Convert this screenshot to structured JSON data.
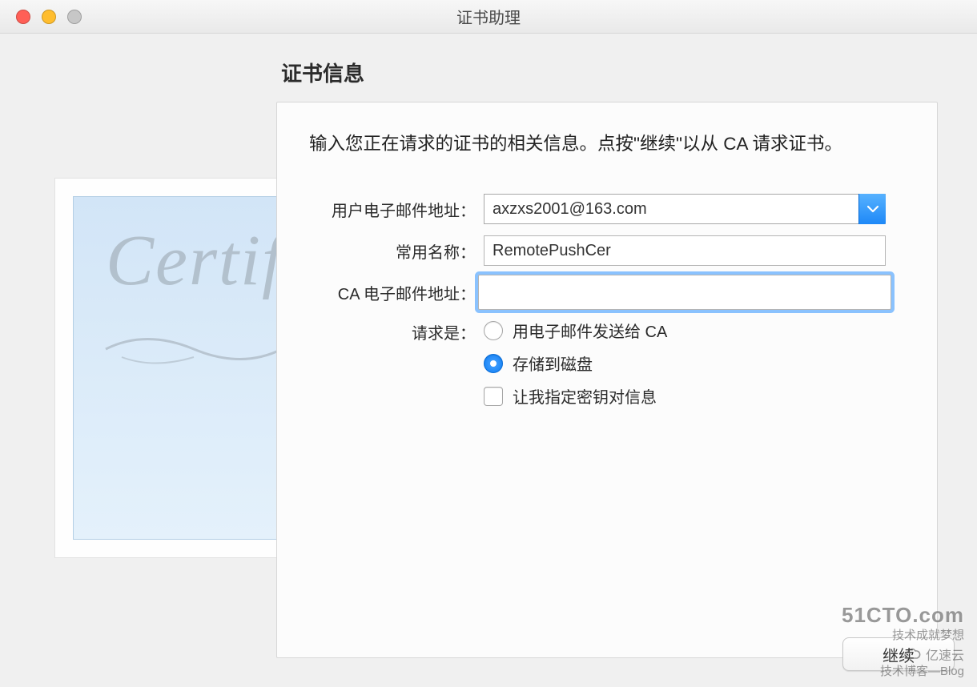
{
  "window": {
    "title": "证书助理"
  },
  "heading": "证书信息",
  "instruction": "输入您正在请求的证书的相关信息。点按\"继续\"以从 CA 请求证书。",
  "form": {
    "email_label": "用户电子邮件地址：",
    "email_value": "axzxs2001@163.com",
    "common_name_label": "常用名称：",
    "common_name_value": "RemotePushCer",
    "ca_email_label": "CA 电子邮件地址：",
    "ca_email_value": "",
    "request_label": "请求是：",
    "option_email_ca": "用电子邮件发送给 CA",
    "option_save_disk": "存储到磁盘",
    "option_specify_keypair": "让我指定密钥对信息"
  },
  "certificate_decor": {
    "script_text": "Certificate"
  },
  "buttons": {
    "continue": "继续"
  },
  "watermark": {
    "site": "51CTO.com",
    "slogan": "技术成就梦想",
    "brand": "亿速云",
    "blog": "技术博客—Blog"
  }
}
